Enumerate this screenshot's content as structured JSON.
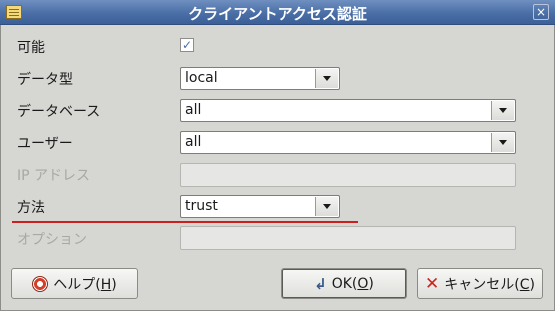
{
  "window": {
    "title": "クライアントアクセス認証",
    "close_symbol": "×"
  },
  "form": {
    "enabled_label": "可能",
    "enabled_checked": true,
    "check_symbol": "✓",
    "type_label": "データ型",
    "type_value": "local",
    "database_label": "データベース",
    "database_value": "all",
    "user_label": "ユーザー",
    "user_value": "all",
    "ip_label": "IP アドレス",
    "ip_value": "",
    "method_label": "方法",
    "method_value": "trust",
    "option_label": "オプション",
    "option_value": ""
  },
  "buttons": {
    "help_prefix": "ヘルプ(",
    "help_key": "H",
    "help_suffix": ")",
    "ok_prefix": "OK(",
    "ok_key": "O",
    "ok_suffix": ")",
    "cancel_prefix": "キャンセル(",
    "cancel_key": "C",
    "cancel_suffix": ")"
  },
  "colors": {
    "title_bar": "#4a6ea6",
    "highlight_line": "#cc1f1f",
    "disabled_text": "#a8a8a5"
  }
}
